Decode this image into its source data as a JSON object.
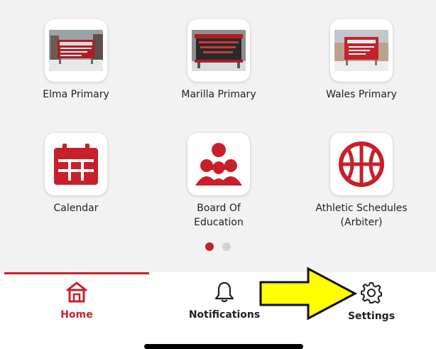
{
  "colors": {
    "accent": "#c8202a",
    "text": "#222222",
    "dot_inactive": "#d2d2d2",
    "tab_inactive": "#222222",
    "arrow_fill": "#ffff00"
  },
  "tiles": [
    {
      "label": "Elma Primary",
      "icon": "elma-primary-photo"
    },
    {
      "label": "Marilla Primary",
      "icon": "marilla-primary-photo"
    },
    {
      "label": "Wales Primary",
      "icon": "wales-primary-photo"
    },
    {
      "label": "Calendar",
      "icon": "calendar-icon"
    },
    {
      "label": "Board Of Education",
      "icon": "people-group-icon"
    },
    {
      "label": "Athletic Schedules (Arbiter)",
      "icon": "basketball-icon"
    }
  ],
  "pagination": {
    "pages": 2,
    "active": 1
  },
  "tabs": [
    {
      "label": "Home",
      "icon": "home-icon",
      "active": true
    },
    {
      "label": "Notifications",
      "icon": "bell-icon",
      "active": false
    },
    {
      "label": "Settings",
      "icon": "gear-icon",
      "active": false
    }
  ],
  "annotation": {
    "icon": "arrow-right-icon",
    "target": "Settings"
  }
}
